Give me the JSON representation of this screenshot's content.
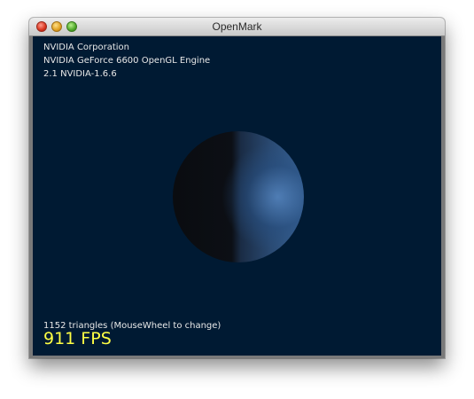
{
  "window": {
    "title": "OpenMark"
  },
  "gl_info": {
    "vendor": "NVIDIA Corporation",
    "renderer": "NVIDIA GeForce 6600 OpenGL Engine",
    "version": "2.1 NVIDIA-1.6.6"
  },
  "stats": {
    "triangles": "1152 triangles (MouseWheel to change)",
    "fps": "911 FPS"
  },
  "colors": {
    "background": "#001a33",
    "fps_text": "#ffff44",
    "info_text": "#e8e8e8"
  }
}
